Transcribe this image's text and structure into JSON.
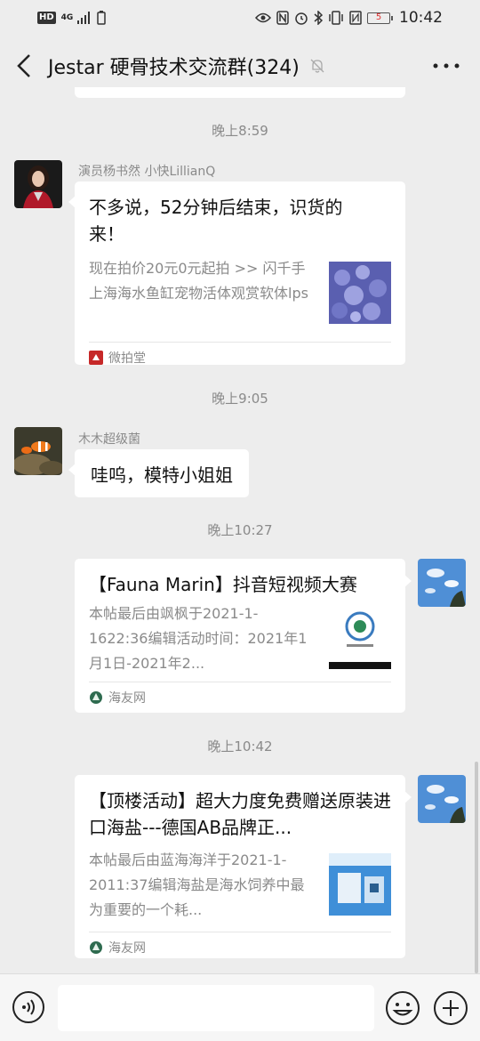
{
  "status_bar": {
    "hd": "HD",
    "network": "4G",
    "battery_level": "5",
    "time": "10:42"
  },
  "header": {
    "title": "Jestar 硬骨技术交流群(324)"
  },
  "messages": {
    "time_1": "晚上8:59",
    "time_2": "晚上9:05",
    "time_3": "晚上10:27",
    "time_4": "晚上10:42",
    "msg1": {
      "sender": "演员杨书然 小快LillianQ",
      "title_line1": "不多说，52分钟后结束，识货的",
      "title_line2": "来！",
      "desc": "现在拍价20元0元起拍 >> 闪千手上海海水鱼缸宠物活体观赏软体lps",
      "source": "微拍堂"
    },
    "msg2": {
      "sender": "木木超级菌",
      "text": "哇呜，模特小姐姐"
    },
    "msg3": {
      "title": "【Fauna Marin】抖音短视频大赛",
      "desc": "本帖最后由飒枫于2021-1-1622:36编辑活动时间：2021年1月1日-2021年2...",
      "source": "海友网"
    },
    "msg4": {
      "title": "【顶楼活动】超大力度免费赠送原装进口海盐---德国AB品牌正...",
      "desc": "本帖最后由蓝海海洋于2021-1-2011:37编辑海盐是海水饲养中最为重要的一个耗...",
      "source": "海友网"
    }
  },
  "colors": {
    "background": "#ededed",
    "bubble": "#ffffff",
    "muted_text": "#8a8a8a"
  }
}
